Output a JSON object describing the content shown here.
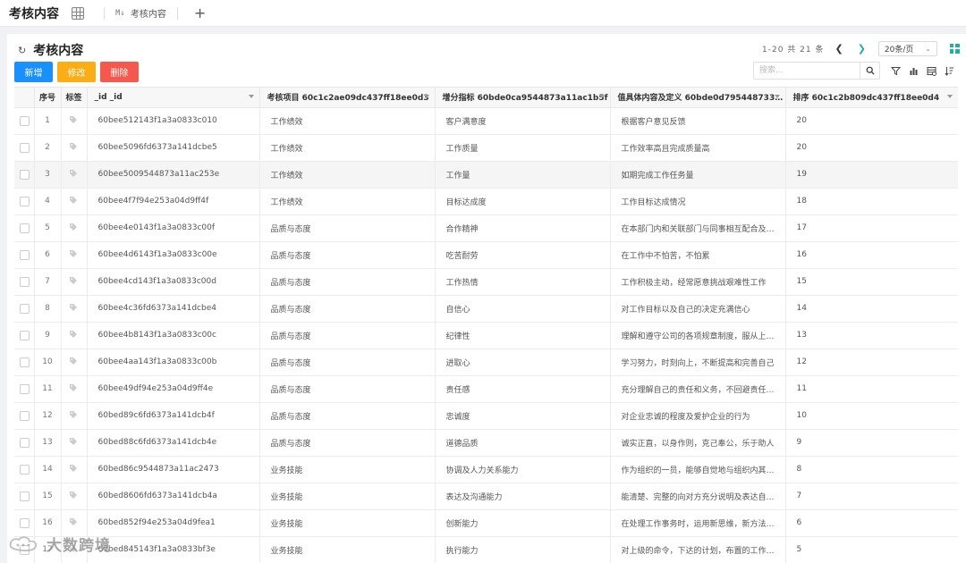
{
  "topbar": {
    "app_title": "考核内容",
    "tab_label": "考核内容",
    "md_badge": "M↓",
    "add_tab": "+"
  },
  "page": {
    "title": "考核内容",
    "pager_info": "1-20 共 21 条",
    "page_size": "20条/页"
  },
  "toolbar": {
    "add_label": "新增",
    "edit_label": "修改",
    "delete_label": "删除",
    "search_placeholder": "搜索..."
  },
  "colors": {
    "primary": "#1890ff",
    "warning": "#faad14",
    "danger": "#f5594e",
    "accent": "#1bb0a8"
  },
  "table": {
    "headers": {
      "index": "序号",
      "tag": "标签",
      "id": "_id _id",
      "item": "考核项目 60c1c2ae09dc437ff18ee0d3",
      "indicator": "增分指标 60bde0ca9544873a11ac1b5f",
      "definition": "值具体内容及定义 60bde0d795448733…",
      "order": "排序 60c1c2b809dc437ff18ee0d4"
    },
    "rows": [
      {
        "index": "1",
        "id": "60bee512143f1a3a0833c010",
        "item": "工作绩效",
        "indicator": "客户满意度",
        "definition": "根据客户意见反馈",
        "order": "20"
      },
      {
        "index": "2",
        "id": "60bee5096fd6373a141dcbe5",
        "item": "工作绩效",
        "indicator": "工作质量",
        "definition": "工作效率高且完成质量高",
        "order": "20"
      },
      {
        "index": "3",
        "id": "60bee5009544873a11ac253e",
        "item": "工作绩效",
        "indicator": "工作量",
        "definition": "如期完成工作任务量",
        "order": "19"
      },
      {
        "index": "4",
        "id": "60bee4f7f94e253a04d9ff4f",
        "item": "工作绩效",
        "indicator": "目标达成度",
        "definition": "工作目标达成情况",
        "order": "18"
      },
      {
        "index": "5",
        "id": "60bee4e0143f1a3a0833c00f",
        "item": "品质与态度",
        "indicator": "合作精神",
        "definition": "在本部门内和关联部门与同事相互配合及…",
        "order": "17"
      },
      {
        "index": "6",
        "id": "60bee4d6143f1a3a0833c00e",
        "item": "品质与态度",
        "indicator": "吃苦耐劳",
        "definition": "在工作中不怕苦，不怕累",
        "order": "16"
      },
      {
        "index": "7",
        "id": "60bee4cd143f1a3a0833c00d",
        "item": "品质与态度",
        "indicator": "工作热情",
        "definition": "工作积极主动，经常愿意挑战艰难性工作",
        "order": "15"
      },
      {
        "index": "8",
        "id": "60bee4c36fd6373a141dcbe4",
        "item": "品质与态度",
        "indicator": "自信心",
        "definition": "对工作目标以及自己的决定充满信心",
        "order": "14"
      },
      {
        "index": "9",
        "id": "60bee4b8143f1a3a0833c00c",
        "item": "品质与态度",
        "indicator": "纪律性",
        "definition": "理解和遵守公司的各项规章制度，服从上…",
        "order": "13"
      },
      {
        "index": "10",
        "id": "60bee4aa143f1a3a0833c00b",
        "item": "品质与态度",
        "indicator": "进取心",
        "definition": "学习努力，时刻向上，不断提高和完善自己",
        "order": "12"
      },
      {
        "index": "11",
        "id": "60bee49df94e253a04d9ff4e",
        "item": "品质与态度",
        "indicator": "责任感",
        "definition": "充分理解自己的责任和义务，不回避责任…",
        "order": "11"
      },
      {
        "index": "12",
        "id": "60bed89c6fd6373a141dcb4f",
        "item": "品质与态度",
        "indicator": "忠诚度",
        "definition": "对企业忠诚的程度及爱护企业的行为",
        "order": "10"
      },
      {
        "index": "13",
        "id": "60bed88c6fd6373a141dcb4e",
        "item": "品质与态度",
        "indicator": "道德品质",
        "definition": "诚实正直，以身作则，克己奉公，乐于助人",
        "order": "9"
      },
      {
        "index": "14",
        "id": "60bed86c9544873a11ac2473",
        "item": "业务技能",
        "indicator": "协调及人力关系能力",
        "definition": "作为组织的一员，能够自觉地与组织内其…",
        "order": "8"
      },
      {
        "index": "15",
        "id": "60bed8606fd6373a141dcb4a",
        "item": "业务技能",
        "indicator": "表达及沟通能力",
        "definition": "能清楚、完整的向对方充分说明及表达自…",
        "order": "7"
      },
      {
        "index": "16",
        "id": "60bed852f94e253a04d9fea1",
        "item": "业务技能",
        "indicator": "创新能力",
        "definition": "在处理工作事务时，运用新思维，新方法…",
        "order": "6"
      },
      {
        "index": "17",
        "id": "60bed845143f1a3a0833bf3e",
        "item": "业务技能",
        "indicator": "执行能力",
        "definition": "对上级的命令，下达的计划，布置的工作…",
        "order": "5"
      }
    ]
  },
  "watermark": {
    "text": "大数跨境"
  }
}
